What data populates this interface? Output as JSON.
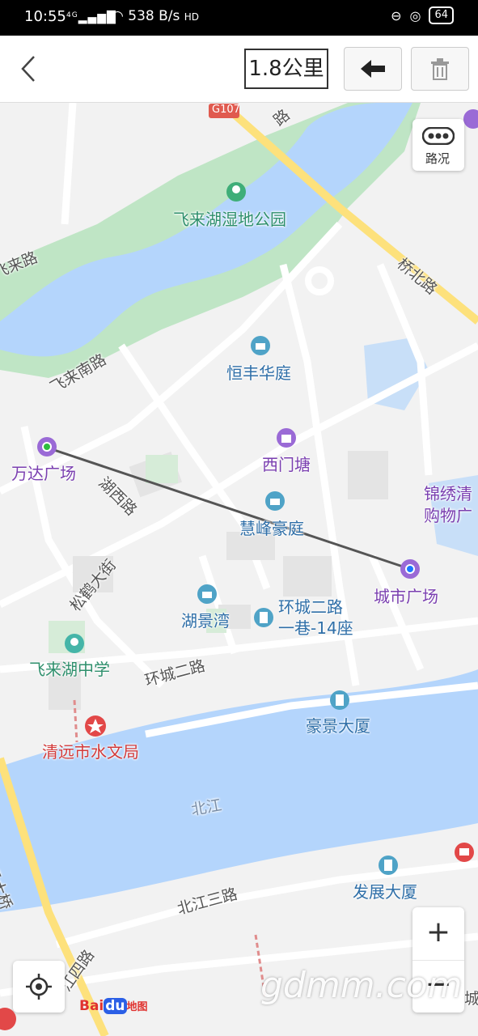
{
  "status_bar": {
    "time": "10:55",
    "signal": "4G",
    "net_speed": "538 B/s",
    "hd": "HD",
    "battery": "64"
  },
  "toolbar": {
    "distance": "1.8公里"
  },
  "map": {
    "places": {
      "wetland_park": "飞来湖湿地公园",
      "hengfeng": "恒丰华庭",
      "ximentang": "西门塘",
      "wanda": "万达广场",
      "huifeng": "慧峰豪庭",
      "city_plaza": "城市广场",
      "jinxiu_line1": "锦绣清",
      "jinxiu_line2": "购物广",
      "hujingwan": "湖景湾",
      "huancheng_line1": "环城二路",
      "huancheng_line2": "一巷-14座",
      "school": "飞来湖中学",
      "haojing": "豪景大厦",
      "water_bureau": "清远市水文局",
      "fazhan": "发展大厦"
    },
    "roads": {
      "g107": "G107",
      "qiaobei": "桥北路",
      "feilainan": "飞来南路",
      "feilai_partial": "飞来路",
      "huxi": "湖西路",
      "songhe": "松鹤大街",
      "huancheng2": "环城二路",
      "beijiang3": "北江三路",
      "jiang4": "江四路",
      "bridge": "清远大桥",
      "top_partial": "路",
      "right_partial": "城"
    },
    "river": "北江",
    "traffic_label": "路况",
    "logo_bai": "Bai",
    "logo_du": "du",
    "logo_map": "地图",
    "watermark": "gdmm.com"
  },
  "colors": {
    "water": "#b4d5fc",
    "park": "#bfe5c5",
    "arterial": "#fde17c",
    "route_line": "#555555"
  }
}
